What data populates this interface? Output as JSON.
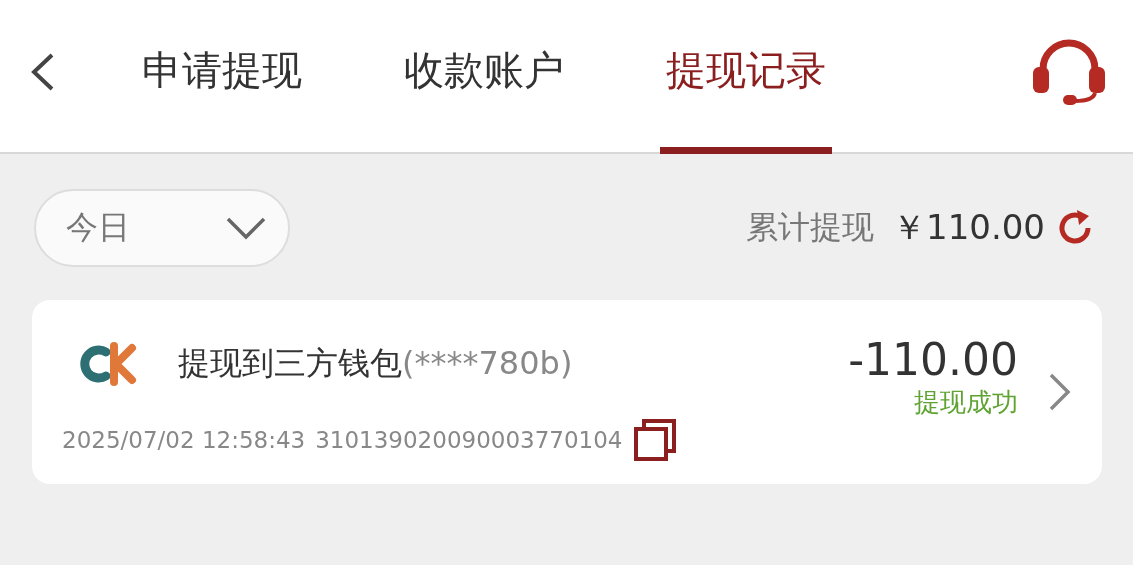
{
  "header": {
    "tabs": [
      {
        "label": "申请提现",
        "selected": false
      },
      {
        "label": "收款账户",
        "selected": false
      },
      {
        "label": "提现记录",
        "selected": true
      }
    ]
  },
  "filter": {
    "value": "今日"
  },
  "summary": {
    "label": "累计提现",
    "amount": "￥110.00"
  },
  "records": [
    {
      "title": "提现到三方钱包",
      "account": "(****780b)",
      "amount": "-110.00",
      "status": "提现成功",
      "time": "2025/07/02 12:58:43",
      "order": "310139020090003770104"
    }
  ]
}
